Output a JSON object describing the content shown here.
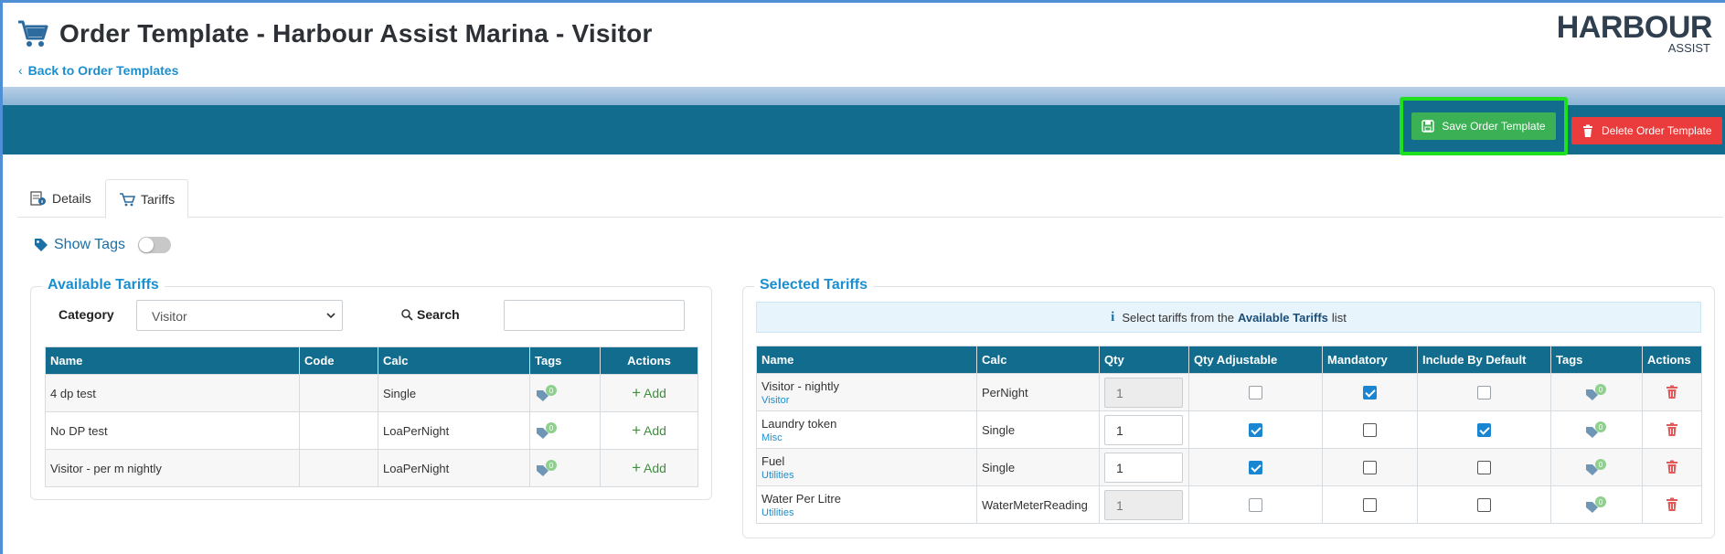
{
  "header": {
    "title": "Order Template - Harbour Assist Marina - Visitor",
    "back_link": "Back to Order Templates",
    "logo_main": "HARBOUR",
    "logo_sub": "ASSIST"
  },
  "toolbar": {
    "save_label": "Save Order Template",
    "delete_label": "Delete Order Template"
  },
  "tabs": [
    {
      "label": "Details",
      "icon": "details-icon",
      "active": false
    },
    {
      "label": "Tariffs",
      "icon": "cart-icon",
      "active": true
    }
  ],
  "show_tags": {
    "label": "Show Tags",
    "enabled": false
  },
  "available": {
    "legend": "Available Tariffs",
    "category_label": "Category",
    "category_value": "Visitor",
    "search_label": "Search",
    "search_value": "",
    "columns": [
      "Name",
      "Code",
      "Calc",
      "Tags",
      "Actions"
    ],
    "rows": [
      {
        "name": "4 dp test",
        "code": "",
        "calc": "Single",
        "tag_count": "0",
        "action": "Add"
      },
      {
        "name": "No DP test",
        "code": "",
        "calc": "LoaPerNight",
        "tag_count": "0",
        "action": "Add"
      },
      {
        "name": "Visitor - per m nightly",
        "code": "",
        "calc": "LoaPerNight",
        "tag_count": "0",
        "action": "Add"
      }
    ]
  },
  "selected": {
    "legend": "Selected Tariffs",
    "info_prefix": "Select tariffs from the",
    "info_bold": "Available Tariffs",
    "info_suffix": "list",
    "columns": [
      "Name",
      "Calc",
      "Qty",
      "Qty Adjustable",
      "Mandatory",
      "Include By Default",
      "Tags",
      "Actions"
    ],
    "rows": [
      {
        "name": "Visitor - nightly",
        "category": "Visitor",
        "calc": "PerNight",
        "qty": "1",
        "qty_editable": false,
        "qty_adjustable": false,
        "mandatory": true,
        "include_by_default": false,
        "tag_count": "0"
      },
      {
        "name": "Laundry token",
        "category": "Misc",
        "calc": "Single",
        "qty": "1",
        "qty_editable": true,
        "qty_adjustable": true,
        "mandatory": false,
        "include_by_default": true,
        "tag_count": "0"
      },
      {
        "name": "Fuel",
        "category": "Utilities",
        "calc": "Single",
        "qty": "1",
        "qty_editable": true,
        "qty_adjustable": true,
        "mandatory": false,
        "include_by_default": false,
        "tag_count": "0"
      },
      {
        "name": "Water Per Litre",
        "category": "Utilities",
        "calc": "WaterMeterReading",
        "qty": "1",
        "qty_editable": false,
        "qty_adjustable": false,
        "mandatory": false,
        "include_by_default": false,
        "tag_count": "0"
      }
    ]
  },
  "colors": {
    "brand_teal": "#116c8e",
    "save_green": "#3cb054",
    "delete_red": "#ea3c3c",
    "highlight": "#1fe01f",
    "link_blue": "#1a8fd0"
  }
}
